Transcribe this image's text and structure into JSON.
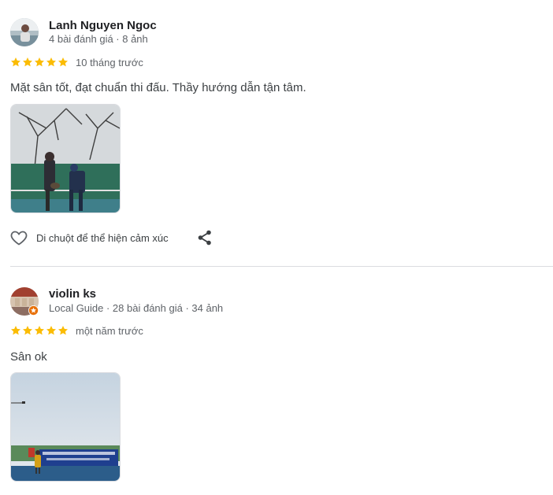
{
  "reviews": [
    {
      "author": "Lanh Nguyen Ngoc",
      "meta": "4 bài đánh giá · 8 ảnh",
      "rating": 5,
      "time": "10 tháng trước",
      "text": "Mặt sân tốt, đạt chuẩn thi đấu. Thầy hướng dẫn tận tâm.",
      "reaction_hint": "Di chuột để thể hiện cảm xúc",
      "avatar_icon": "user-photo-avatar",
      "photo": "tennis-coaching-photo"
    },
    {
      "author": "violin ks",
      "meta": "Local Guide · 28 bài đánh giá · 34 ảnh",
      "rating": 5,
      "time": "một năm trước",
      "text": "Sân ok",
      "avatar_icon": "local-guide-avatar",
      "photo": "tennis-court-photo"
    }
  ],
  "colors": {
    "star": "#fbbc04",
    "text_secondary": "#5f6368",
    "divider": "#dadce0",
    "local_guide_badge": "#e8710a"
  },
  "icons": {
    "like": "heart-outline-icon",
    "share": "share-icon",
    "star": "star-icon"
  }
}
